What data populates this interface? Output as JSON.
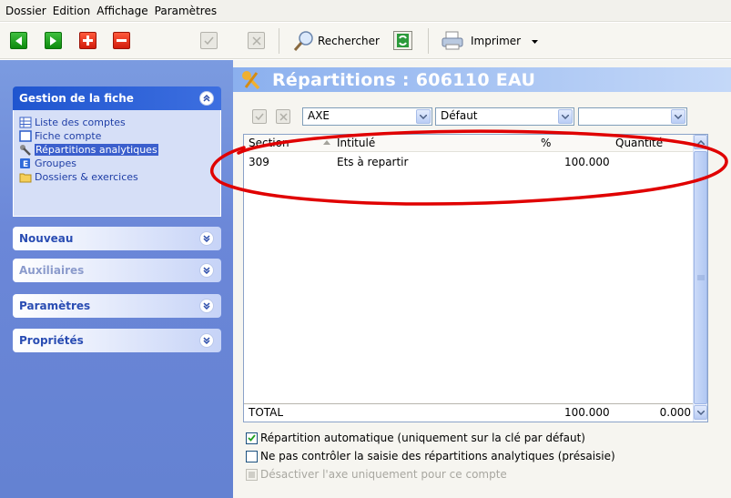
{
  "menu": [
    "Dossier",
    "Edition",
    "Affichage",
    "Paramètres"
  ],
  "toolbar": {
    "search_label": "Rechercher",
    "print_label": "Imprimer"
  },
  "sidebar": {
    "panel_title": "Gestion de la fiche",
    "tasks": [
      {
        "label": "Liste des comptes",
        "icon": "grid-list-icon"
      },
      {
        "label": "Fiche compte",
        "icon": "account-card-icon"
      },
      {
        "label": "Répartitions analytiques",
        "icon": "tools-icon",
        "selected": true
      },
      {
        "label": "Groupes",
        "icon": "groups-icon"
      },
      {
        "label": "Dossiers & exercices",
        "icon": "folder-icon"
      }
    ],
    "sections": [
      {
        "label": "Nouveau",
        "disabled": false
      },
      {
        "label": "Auxiliaires",
        "disabled": true
      },
      {
        "label": "Paramètres",
        "disabled": false
      },
      {
        "label": "Propriétés",
        "disabled": false
      }
    ]
  },
  "main": {
    "title": "Répartitions : 606110 EAU",
    "axe_value": "AXE",
    "key_value": "Défaut",
    "extra_value": ""
  },
  "grid": {
    "columns": [
      "Section",
      "Intitulé",
      "%",
      "Quantité"
    ],
    "rows": [
      {
        "section": "309",
        "intitule": "Ets à repartir",
        "pct": "100.000",
        "qty": ""
      }
    ],
    "total": {
      "label": "TOTAL",
      "pct": "100.000",
      "qty": "0.000"
    }
  },
  "options": [
    {
      "label": "Répartition automatique (uniquement sur la clé par défaut)",
      "checked": true,
      "disabled": false
    },
    {
      "label": "Ne pas contrôler la saisie des répartitions analytiques (présaisie)",
      "checked": false,
      "disabled": false
    },
    {
      "label": "Désactiver l'axe uniquement pour ce compte",
      "checked": false,
      "disabled": true
    }
  ],
  "colors": {
    "sidebar": "#6b87d8",
    "title_bar": "#8bb0ee",
    "annotation": "#e00000"
  }
}
